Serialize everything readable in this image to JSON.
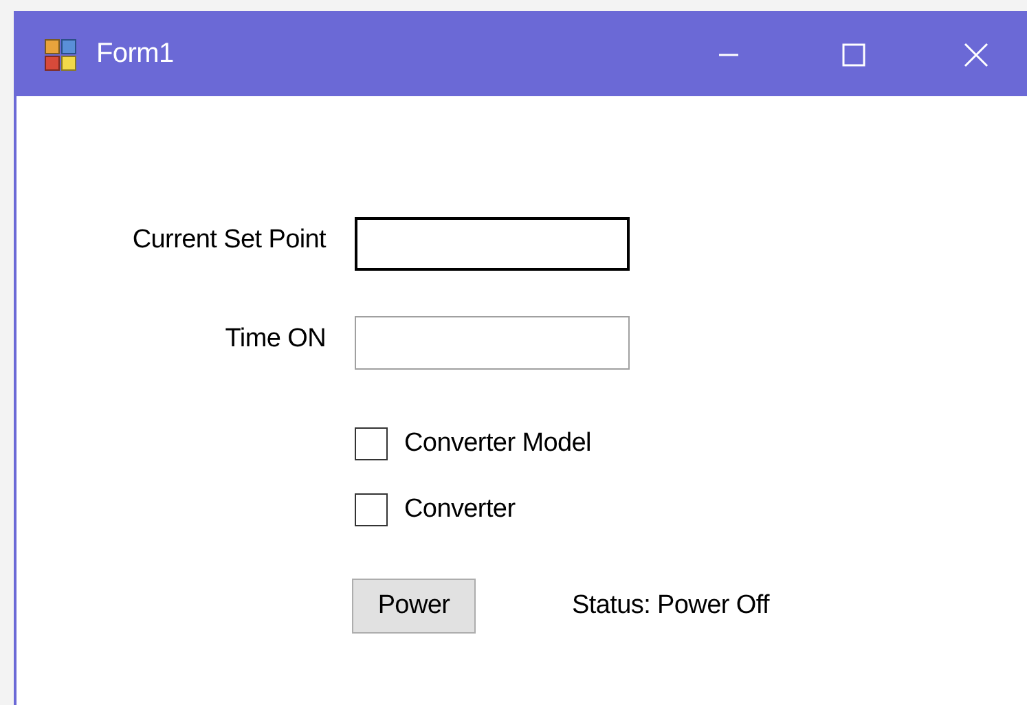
{
  "window": {
    "title": "Form1"
  },
  "fields": [
    {
      "label": "Current Set Point",
      "focused": true
    },
    {
      "label": "Time ON",
      "focused": false
    }
  ],
  "checkboxes": [
    {
      "label": "Converter Model",
      "checked": false
    },
    {
      "label": "Converter",
      "checked": false
    }
  ],
  "button": {
    "label": "Power"
  },
  "status": "Status: Power Off"
}
